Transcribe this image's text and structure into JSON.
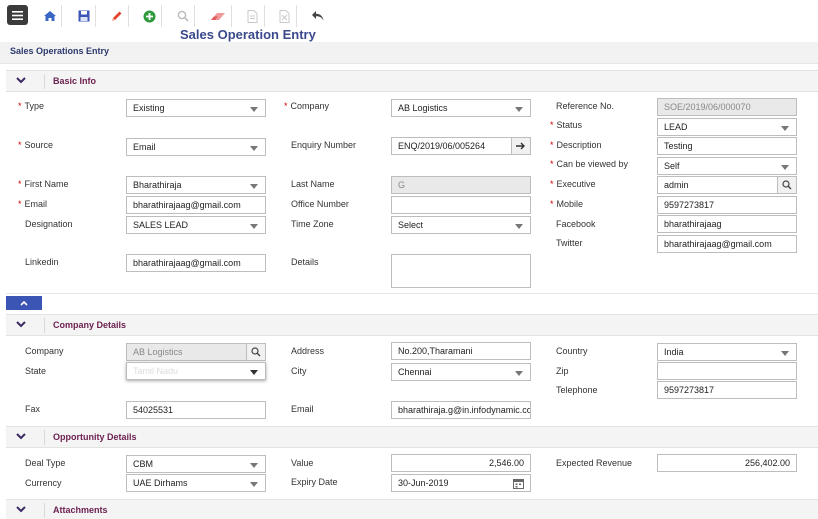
{
  "title": "Sales Operation Entry",
  "breadcrumb": "Sales Operations Entry",
  "sections": {
    "basic": "Basic Info",
    "company": "Company Details",
    "opportunity": "Opportunity Details",
    "attachments": "Attachments"
  },
  "basic": {
    "type_label": "Type",
    "type_value": "Existing",
    "company_label": "Company",
    "company_value": "AB Logistics",
    "ref_label": "Reference No.",
    "ref_value": "SOE/2019/06/000070",
    "status_label": "Status",
    "status_value": "LEAD",
    "source_label": "Source",
    "source_value": "Email",
    "enquiry_label": "Enquiry Number",
    "enquiry_value": "ENQ/2019/06/005264",
    "description_label": "Description",
    "description_value": "Testing",
    "viewed_label": "Can be viewed by",
    "viewed_value": "Self",
    "firstname_label": "First Name",
    "firstname_value": "Bharathiraja",
    "lastname_label": "Last Name",
    "lastname_value": "G",
    "executive_label": "Executive",
    "executive_value": "admin",
    "email_label": "Email",
    "email_value": "bharathirajaag@gmail.com",
    "office_label": "Office Number",
    "office_value": "",
    "mobile_label": "Mobile",
    "mobile_value": "9597273817",
    "designation_label": "Designation",
    "designation_value": "SALES LEAD",
    "timezone_label": "Time Zone",
    "timezone_value": "Select",
    "facebook_label": "Facebook",
    "facebook_value": "bharathirajaag",
    "twitter_label": "Twitter",
    "twitter_value": "bharathirajaag@gmail.com",
    "linkedin_label": "Linkedin",
    "linkedin_value": "bharathirajaag@gmail.com",
    "details_label": "Details",
    "details_value": ""
  },
  "company": {
    "company_label": "Company",
    "company_value": "AB Logistics",
    "address_label": "Address",
    "address_value": "No.200,Tharamani",
    "country_label": "Country",
    "country_value": "India",
    "state_label": "State",
    "state_value": "Tamil Nadu",
    "city_label": "City",
    "city_value": "Chennai",
    "zip_label": "Zip",
    "zip_value": "",
    "telephone_label": "Telephone",
    "telephone_value": "9597273817",
    "fax_label": "Fax",
    "fax_value": "54025531",
    "email_label": "Email",
    "email_value": "bharathiraja.g@in.infodynamic.co"
  },
  "opportunity": {
    "dealtype_label": "Deal Type",
    "dealtype_value": "CBM",
    "value_label": "Value",
    "value_value": "2,546.00",
    "expected_label": "Expected Revenue",
    "expected_value": "256,402.00",
    "currency_label": "Currency",
    "currency_value": "UAE Dirhams",
    "expiry_label": "Expiry Date",
    "expiry_value": "30-Jun-2019"
  },
  "icons": [
    "menu-icon",
    "home-icon",
    "save-icon",
    "edit-icon",
    "add-icon",
    "search-icon",
    "eraser-icon",
    "document-icon",
    "export-icon",
    "undo-icon"
  ],
  "colors": {
    "accent": "#3a55b3",
    "section_title": "#6b1f4f",
    "page_title": "#3a4a8c",
    "required": "#cc0000"
  }
}
